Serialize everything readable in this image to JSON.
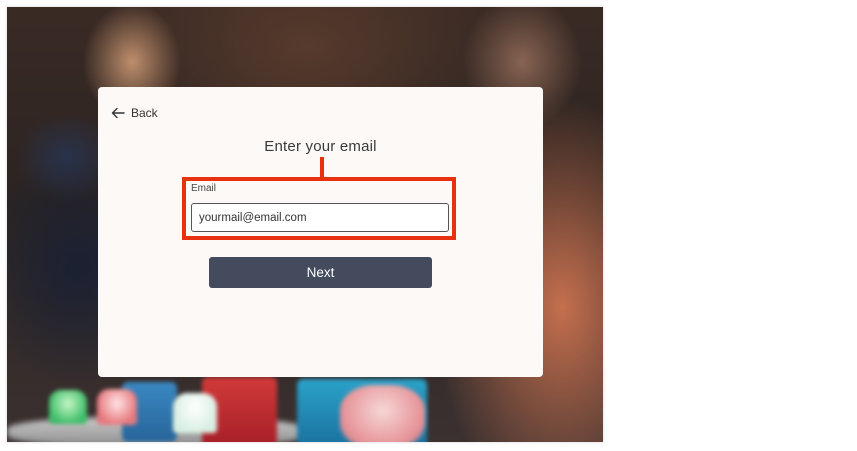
{
  "back": {
    "icon": "arrow-left-icon",
    "label": "Back"
  },
  "form": {
    "title": "Enter your email",
    "email_label": "Email",
    "email_value": "yourmail@email.com"
  },
  "actions": {
    "next_label": "Next"
  },
  "colors": {
    "highlight": "#e8320f",
    "button": "#444b5c",
    "card": "#fdf9f6"
  }
}
